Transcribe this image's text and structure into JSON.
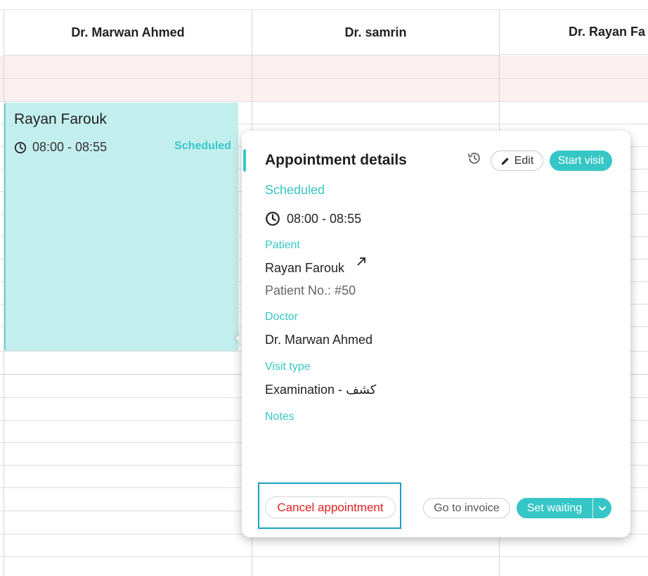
{
  "doctors": [
    "Dr. Marwan Ahmed",
    "Dr. samrin",
    "Dr. Rayan Fa"
  ],
  "event": {
    "patient_name": "Rayan Farouk",
    "time": "08:00 - 08:55",
    "status": "Scheduled"
  },
  "popup": {
    "title": "Appointment details",
    "edit_label": "Edit",
    "start_visit_label": "Start visit",
    "status": "Scheduled",
    "time": "08:00 - 08:55",
    "patient_label": "Patient",
    "patient_name": "Rayan Farouk",
    "patient_number": "Patient No.: #50",
    "doctor_label": "Doctor",
    "doctor_name": "Dr. Marwan Ahmed",
    "visit_type_label": "Visit type",
    "visit_type": "Examination - كشف",
    "notes_label": "Notes",
    "cancel_label": "Cancel appointment",
    "invoice_label": "Go to invoice",
    "set_waiting_label": "Set waiting"
  },
  "colors": {
    "accent": "#37c6c6",
    "event_bg": "#c3eeee",
    "cancel": "#e02020",
    "highlight_frame": "#1aa0c0",
    "pink_row": "#fcefef"
  },
  "icons": [
    "clock-icon",
    "history-icon",
    "pencil-icon",
    "external-link-icon",
    "chevron-down-icon"
  ]
}
